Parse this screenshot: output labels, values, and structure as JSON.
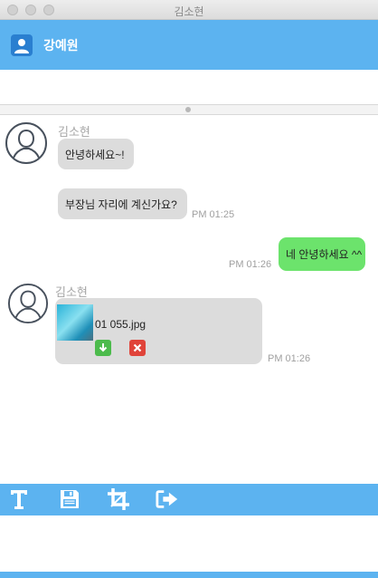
{
  "window": {
    "title": "김소현"
  },
  "header": {
    "contact_name": "강예원",
    "icon": "user-icon"
  },
  "colors": {
    "accent": "#5cb3f0",
    "my_bubble": "#6ce36c",
    "other_bubble": "#dcdcdc",
    "accept": "#4cbb4c",
    "reject": "#e0443a"
  },
  "messages": [
    {
      "sender": "김소현",
      "text": "안녕하세요~!",
      "time": ""
    },
    {
      "sender": "",
      "text": "부장님 자리에 계신가요?",
      "time": "PM 01:25"
    },
    {
      "sender": "me",
      "text": "네 안녕하세요 ^^",
      "time": "PM 01:26"
    },
    {
      "sender": "김소현",
      "file_name": "01 055.jpg",
      "time": "PM 01:26",
      "download_icon": "download-icon",
      "reject_icon": "reject-icon"
    }
  ],
  "toolbar": {
    "items": [
      {
        "name": "text-format-icon"
      },
      {
        "name": "save-icon"
      },
      {
        "name": "crop-icon"
      },
      {
        "name": "exit-icon"
      }
    ]
  }
}
